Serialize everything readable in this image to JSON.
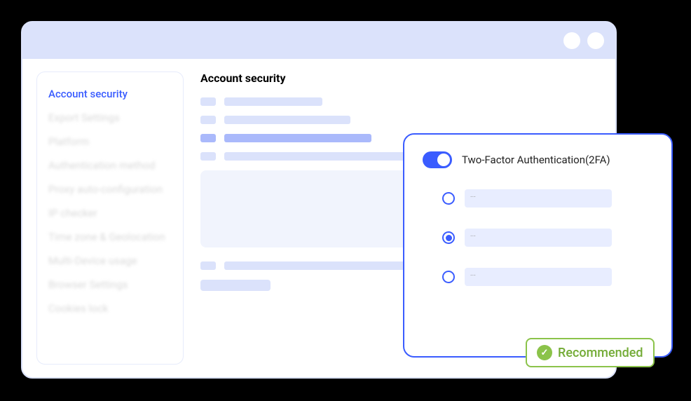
{
  "sidebar": {
    "items": [
      {
        "label": "Account security",
        "active": true
      },
      {
        "label": "Export Settings"
      },
      {
        "label": "Platform"
      },
      {
        "label": "Authentication method"
      },
      {
        "label": "Proxy auto-configuration"
      },
      {
        "label": "IP checker"
      },
      {
        "label": "Time zone & Geolocation"
      },
      {
        "label": "Multi-Device usage"
      },
      {
        "label": "Browser Settings"
      },
      {
        "label": "Cookies lock"
      }
    ]
  },
  "main": {
    "title": "Account security"
  },
  "popup": {
    "title": "Two-Factor Authentication(2FA)",
    "toggle_on": true,
    "options": [
      {
        "label": "...",
        "selected": false
      },
      {
        "label": "...",
        "selected": true
      },
      {
        "label": "...",
        "selected": false
      }
    ]
  },
  "badge": {
    "text": "Recommended"
  },
  "colors": {
    "accent": "#3a5cff",
    "surface": "#dbe2fb",
    "success": "#8bc34a"
  }
}
